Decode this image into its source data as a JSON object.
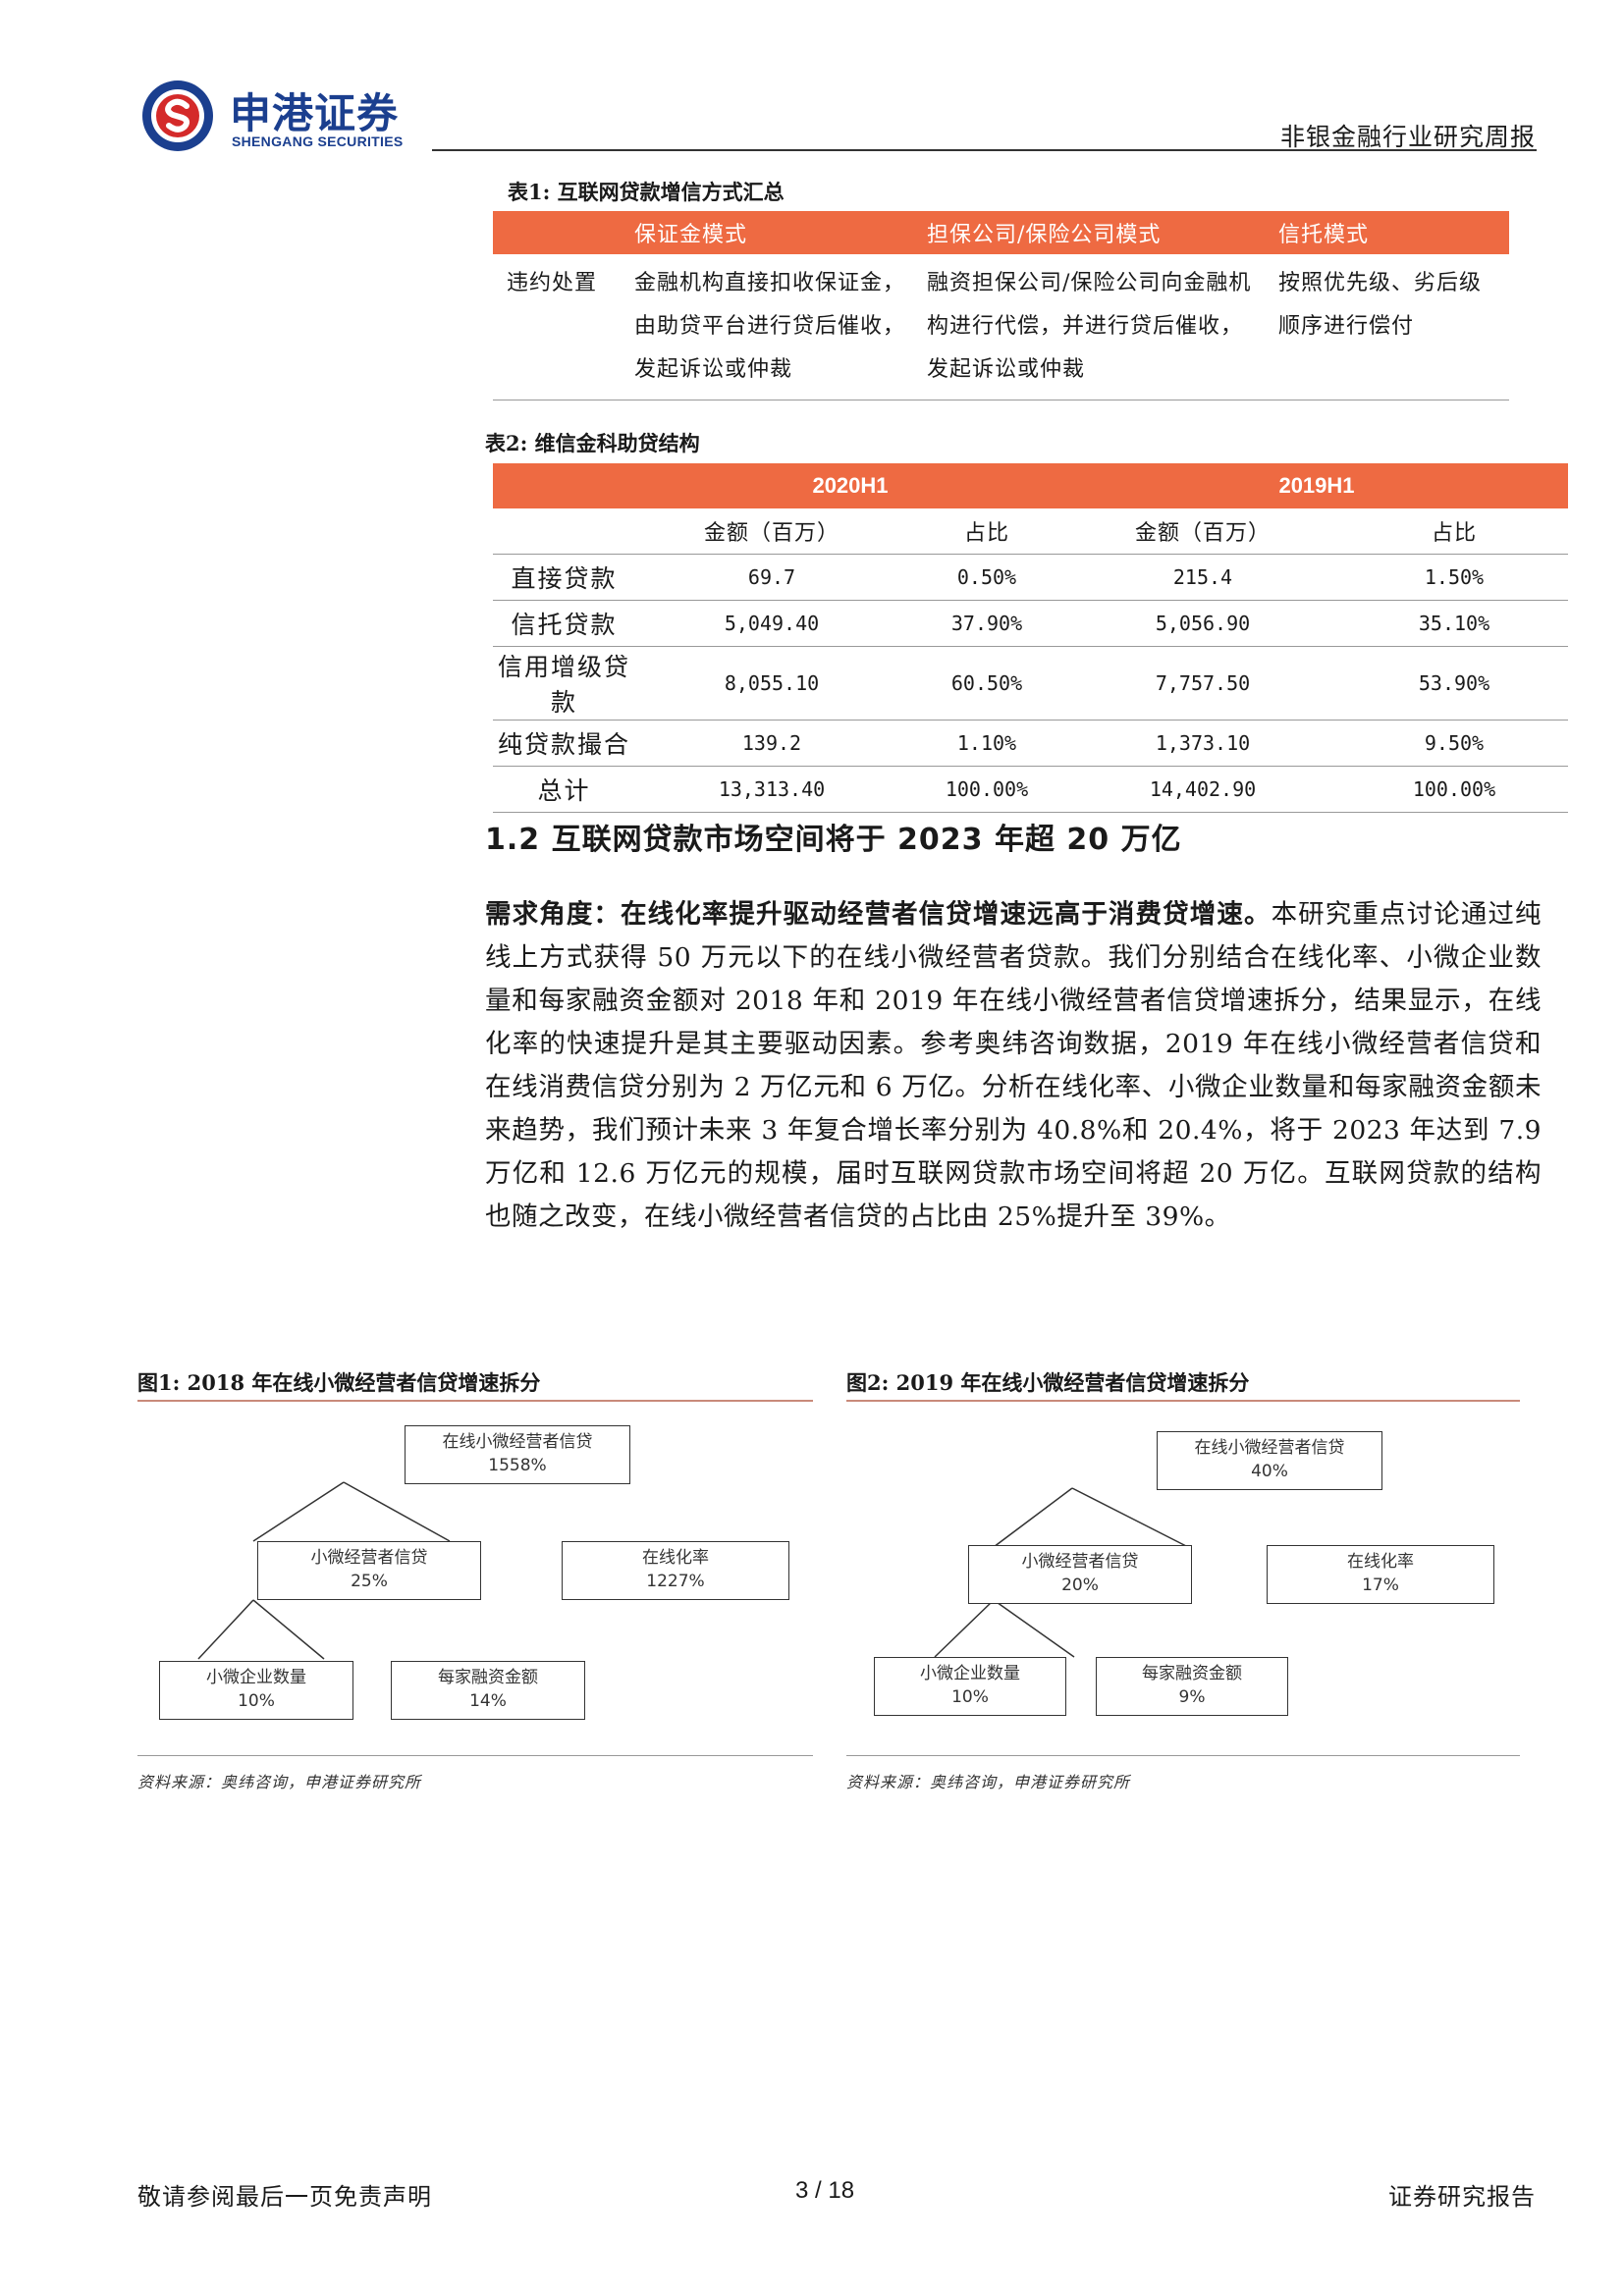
{
  "header": {
    "logo_cn": "申港证券",
    "logo_en": "SHENGANG SECURITIES",
    "report_type": "非银金融行业研究周报"
  },
  "table1": {
    "caption": "表1: 互联网贷款增信方式汇总",
    "headers": [
      "",
      "保证金模式",
      "担保公司/保险公司模式",
      "信托模式"
    ],
    "rows": [
      [
        "违约处置",
        "金融机构直接扣收保证金，由助贷平台进行贷后催收，发起诉讼或仲裁",
        "融资担保公司/保险公司向金融机构进行代偿，并进行贷后催收，发起诉讼或仲裁",
        "按照优先级、劣后级顺序进行偿付"
      ]
    ]
  },
  "table2": {
    "caption": "表2: 维信金科助贷结构",
    "groups": [
      "2020H1",
      "2019H1"
    ],
    "subheaders": [
      "金额（百万）",
      "占比",
      "金额（百万）",
      "占比"
    ],
    "rows": [
      {
        "label": "直接贷款",
        "v": [
          "69.7",
          "0.50%",
          "215.4",
          "1.50%"
        ]
      },
      {
        "label": "信托贷款",
        "v": [
          "5,049.40",
          "37.90%",
          "5,056.90",
          "35.10%"
        ]
      },
      {
        "label": "信用增级贷款",
        "v": [
          "8,055.10",
          "60.50%",
          "7,757.50",
          "53.90%"
        ]
      },
      {
        "label": "纯贷款撮合",
        "v": [
          "139.2",
          "1.10%",
          "1,373.10",
          "9.50%"
        ]
      },
      {
        "label": "总计",
        "v": [
          "13,313.40",
          "100.00%",
          "14,402.90",
          "100.00%"
        ]
      }
    ]
  },
  "section": {
    "title": "1.2 互联网贷款市场空间将于 2023 年超 20 万亿",
    "lead": "需求角度：在线化率提升驱动经营者信贷增速远高于消费贷增速。",
    "body": "本研究重点讨论通过纯线上方式获得 50 万元以下的在线小微经营者贷款。我们分别结合在线化率、小微企业数量和每家融资金额对 2018 年和 2019 年在线小微经营者信贷增速拆分，结果显示，在线化率的快速提升是其主要驱动因素。参考奥纬咨询数据，2019 年在线小微经营者信贷和在线消费信贷分别为 2 万亿元和 6 万亿。分析在线化率、小微企业数量和每家融资金额未来趋势，我们预计未来 3 年复合增长率分别为 40.8%和 20.4%，将于 2023 年达到 7.9 万亿和 12.6 万亿元的规模，届时互联网贷款市场空间将超 20 万亿。互联网贷款的结构也随之改变，在线小微经营者信贷的占比由 25%提升至 39%。"
  },
  "figure1": {
    "caption": "图1: 2018 年在线小微经营者信贷增速拆分",
    "root": {
      "name": "在线小微经营者信贷",
      "value": "1558%"
    },
    "mid_left": {
      "name": "小微经营者信贷",
      "value": "25%"
    },
    "mid_right": {
      "name": "在线化率",
      "value": "1227%"
    },
    "leaf_left": {
      "name": "小微企业数量",
      "value": "10%"
    },
    "leaf_right": {
      "name": "每家融资金额",
      "value": "14%"
    },
    "source": "资料来源：奥纬咨询，申港证券研究所"
  },
  "figure2": {
    "caption": "图2: 2019 年在线小微经营者信贷增速拆分",
    "root": {
      "name": "在线小微经营者信贷",
      "value": "40%"
    },
    "mid_left": {
      "name": "小微经营者信贷",
      "value": "20%"
    },
    "mid_right": {
      "name": "在线化率",
      "value": "17%"
    },
    "leaf_left": {
      "name": "小微企业数量",
      "value": "10%"
    },
    "leaf_right": {
      "name": "每家融资金额",
      "value": "9%"
    },
    "source": "资料来源：奥纬咨询，申港证券研究所"
  },
  "footer": {
    "left": "敬请参阅最后一页免责声明",
    "page": "3 / 18",
    "right": "证券研究报告"
  },
  "colors": {
    "accent": "#ee6a42",
    "brand_blue": "#1b3f8f",
    "brand_red": "#d42a2a"
  }
}
